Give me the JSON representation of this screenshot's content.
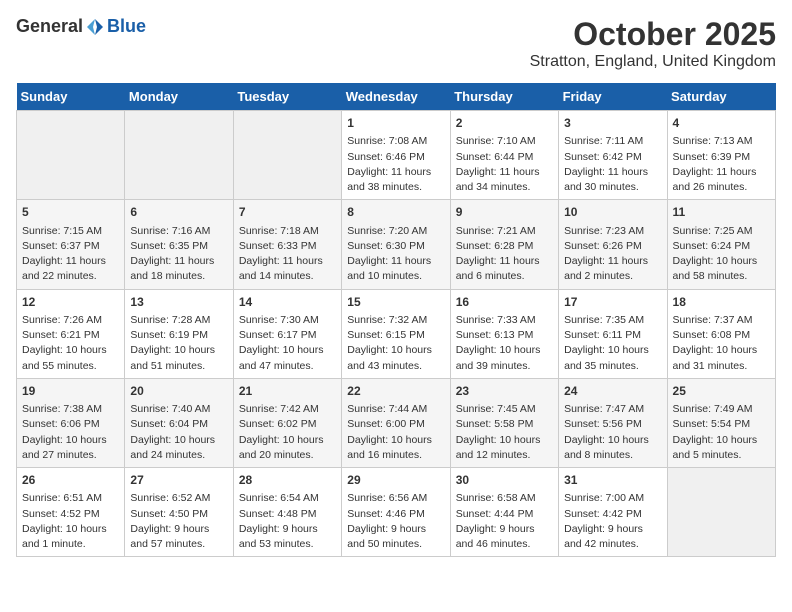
{
  "logo": {
    "general": "General",
    "blue": "Blue"
  },
  "title": "October 2025",
  "subtitle": "Stratton, England, United Kingdom",
  "headers": [
    "Sunday",
    "Monday",
    "Tuesday",
    "Wednesday",
    "Thursday",
    "Friday",
    "Saturday"
  ],
  "weeks": [
    [
      {
        "day": "",
        "info": ""
      },
      {
        "day": "",
        "info": ""
      },
      {
        "day": "",
        "info": ""
      },
      {
        "day": "1",
        "info": "Sunrise: 7:08 AM\nSunset: 6:46 PM\nDaylight: 11 hours and 38 minutes."
      },
      {
        "day": "2",
        "info": "Sunrise: 7:10 AM\nSunset: 6:44 PM\nDaylight: 11 hours and 34 minutes."
      },
      {
        "day": "3",
        "info": "Sunrise: 7:11 AM\nSunset: 6:42 PM\nDaylight: 11 hours and 30 minutes."
      },
      {
        "day": "4",
        "info": "Sunrise: 7:13 AM\nSunset: 6:39 PM\nDaylight: 11 hours and 26 minutes."
      }
    ],
    [
      {
        "day": "5",
        "info": "Sunrise: 7:15 AM\nSunset: 6:37 PM\nDaylight: 11 hours and 22 minutes."
      },
      {
        "day": "6",
        "info": "Sunrise: 7:16 AM\nSunset: 6:35 PM\nDaylight: 11 hours and 18 minutes."
      },
      {
        "day": "7",
        "info": "Sunrise: 7:18 AM\nSunset: 6:33 PM\nDaylight: 11 hours and 14 minutes."
      },
      {
        "day": "8",
        "info": "Sunrise: 7:20 AM\nSunset: 6:30 PM\nDaylight: 11 hours and 10 minutes."
      },
      {
        "day": "9",
        "info": "Sunrise: 7:21 AM\nSunset: 6:28 PM\nDaylight: 11 hours and 6 minutes."
      },
      {
        "day": "10",
        "info": "Sunrise: 7:23 AM\nSunset: 6:26 PM\nDaylight: 11 hours and 2 minutes."
      },
      {
        "day": "11",
        "info": "Sunrise: 7:25 AM\nSunset: 6:24 PM\nDaylight: 10 hours and 58 minutes."
      }
    ],
    [
      {
        "day": "12",
        "info": "Sunrise: 7:26 AM\nSunset: 6:21 PM\nDaylight: 10 hours and 55 minutes."
      },
      {
        "day": "13",
        "info": "Sunrise: 7:28 AM\nSunset: 6:19 PM\nDaylight: 10 hours and 51 minutes."
      },
      {
        "day": "14",
        "info": "Sunrise: 7:30 AM\nSunset: 6:17 PM\nDaylight: 10 hours and 47 minutes."
      },
      {
        "day": "15",
        "info": "Sunrise: 7:32 AM\nSunset: 6:15 PM\nDaylight: 10 hours and 43 minutes."
      },
      {
        "day": "16",
        "info": "Sunrise: 7:33 AM\nSunset: 6:13 PM\nDaylight: 10 hours and 39 minutes."
      },
      {
        "day": "17",
        "info": "Sunrise: 7:35 AM\nSunset: 6:11 PM\nDaylight: 10 hours and 35 minutes."
      },
      {
        "day": "18",
        "info": "Sunrise: 7:37 AM\nSunset: 6:08 PM\nDaylight: 10 hours and 31 minutes."
      }
    ],
    [
      {
        "day": "19",
        "info": "Sunrise: 7:38 AM\nSunset: 6:06 PM\nDaylight: 10 hours and 27 minutes."
      },
      {
        "day": "20",
        "info": "Sunrise: 7:40 AM\nSunset: 6:04 PM\nDaylight: 10 hours and 24 minutes."
      },
      {
        "day": "21",
        "info": "Sunrise: 7:42 AM\nSunset: 6:02 PM\nDaylight: 10 hours and 20 minutes."
      },
      {
        "day": "22",
        "info": "Sunrise: 7:44 AM\nSunset: 6:00 PM\nDaylight: 10 hours and 16 minutes."
      },
      {
        "day": "23",
        "info": "Sunrise: 7:45 AM\nSunset: 5:58 PM\nDaylight: 10 hours and 12 minutes."
      },
      {
        "day": "24",
        "info": "Sunrise: 7:47 AM\nSunset: 5:56 PM\nDaylight: 10 hours and 8 minutes."
      },
      {
        "day": "25",
        "info": "Sunrise: 7:49 AM\nSunset: 5:54 PM\nDaylight: 10 hours and 5 minutes."
      }
    ],
    [
      {
        "day": "26",
        "info": "Sunrise: 6:51 AM\nSunset: 4:52 PM\nDaylight: 10 hours and 1 minute."
      },
      {
        "day": "27",
        "info": "Sunrise: 6:52 AM\nSunset: 4:50 PM\nDaylight: 9 hours and 57 minutes."
      },
      {
        "day": "28",
        "info": "Sunrise: 6:54 AM\nSunset: 4:48 PM\nDaylight: 9 hours and 53 minutes."
      },
      {
        "day": "29",
        "info": "Sunrise: 6:56 AM\nSunset: 4:46 PM\nDaylight: 9 hours and 50 minutes."
      },
      {
        "day": "30",
        "info": "Sunrise: 6:58 AM\nSunset: 4:44 PM\nDaylight: 9 hours and 46 minutes."
      },
      {
        "day": "31",
        "info": "Sunrise: 7:00 AM\nSunset: 4:42 PM\nDaylight: 9 hours and 42 minutes."
      },
      {
        "day": "",
        "info": ""
      }
    ]
  ]
}
